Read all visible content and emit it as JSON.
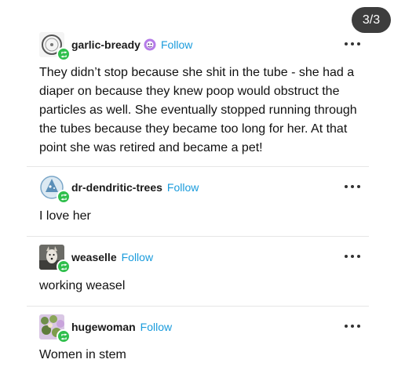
{
  "pagination": {
    "label": "3/3"
  },
  "colors": {
    "follow": "#199bdc",
    "reblog_badge": "#2fbf4c",
    "page_badge": "#3d3d3d"
  },
  "posts": [
    {
      "username": "garlic-bready",
      "follow_label": "Follow",
      "has_verified_badge": true,
      "avatar_icon": "circle-logo-avatar",
      "text": "They didn’t stop because she shit in the tube - she had a diaper on because they knew poop would obstruct the particles as well. She eventually stopped running through the tubes because they became too long for her. At that point she was retired and became a pet!"
    },
    {
      "username": "dr-dendritic-trees",
      "follow_label": "Follow",
      "avatar_icon": "wizard-avatar",
      "text": "I love her"
    },
    {
      "username": "weaselle",
      "follow_label": "Follow",
      "avatar_icon": "dog-photo-avatar",
      "text": "working weasel"
    },
    {
      "username": "hugewoman",
      "follow_label": "Follow",
      "avatar_icon": "plants-photo-avatar",
      "text": "Women in stem"
    }
  ]
}
